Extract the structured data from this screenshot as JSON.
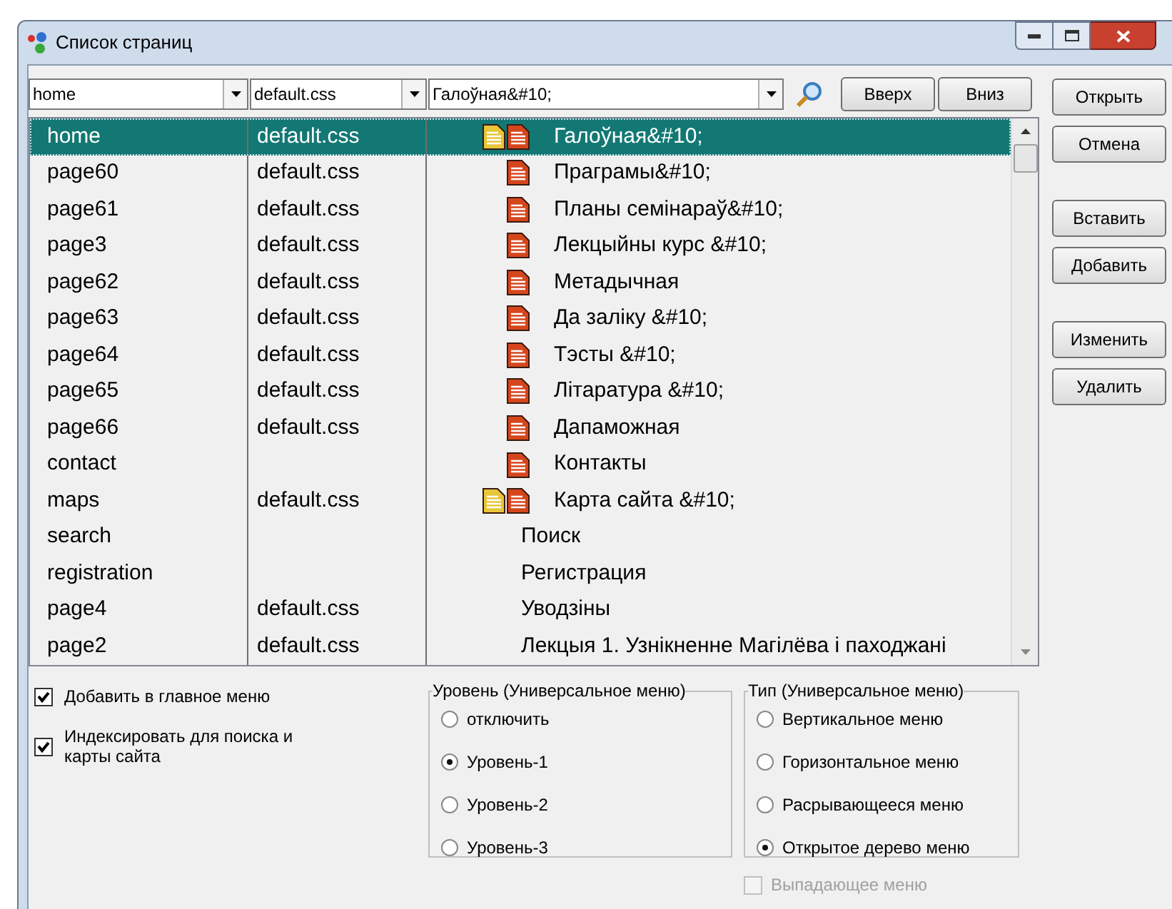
{
  "window": {
    "title": "Список страниц"
  },
  "filters": {
    "page": "home",
    "stylesheet": "default.css",
    "title": "Галоўная&#10;"
  },
  "toolbar_buttons": [
    "Вверх",
    "Вниз"
  ],
  "pages": [
    {
      "page": "home",
      "stylesheet": "default.css",
      "icons": [
        {
          "color": "#e8c63a"
        },
        {
          "color": "#d6461c"
        }
      ],
      "title": "Галоўная&#10;",
      "selected": true
    },
    {
      "page": "page60",
      "stylesheet": "default.css",
      "icons": [
        {
          "color": "#d6461c"
        }
      ],
      "title": "Праграмы&#10;",
      "selected": false
    },
    {
      "page": "page61",
      "stylesheet": "default.css",
      "icons": [
        {
          "color": "#d6461c"
        }
      ],
      "title": "Планы семінараў&#10;",
      "selected": false
    },
    {
      "page": "page3",
      "stylesheet": "default.css",
      "icons": [
        {
          "color": "#d6461c"
        }
      ],
      "title": "Лекцыйны курс &#10;",
      "selected": false
    },
    {
      "page": "page62",
      "stylesheet": "default.css",
      "icons": [
        {
          "color": "#d6461c"
        }
      ],
      "title": "Метадычная",
      "selected": false
    },
    {
      "page": "page63",
      "stylesheet": "default.css",
      "icons": [
        {
          "color": "#d6461c"
        }
      ],
      "title": "Да заліку &#10;",
      "selected": false
    },
    {
      "page": "page64",
      "stylesheet": "default.css",
      "icons": [
        {
          "color": "#d6461c"
        }
      ],
      "title": "Тэсты &#10;",
      "selected": false
    },
    {
      "page": "page65",
      "stylesheet": "default.css",
      "icons": [
        {
          "color": "#d6461c"
        }
      ],
      "title": "Літаратура &#10;",
      "selected": false
    },
    {
      "page": "page66",
      "stylesheet": "default.css",
      "icons": [
        {
          "color": "#d6461c"
        }
      ],
      "title": "Дапаможная",
      "selected": false
    },
    {
      "page": "contact",
      "icons": [
        {
          "color": "#d6461c"
        }
      ],
      "title": "Контакты",
      "selected": false
    },
    {
      "page": "maps",
      "stylesheet": "default.css",
      "icons": [
        {
          "color": "#e8c63a"
        },
        {
          "color": "#d6461c"
        }
      ],
      "title": "Карта сайта &#10;",
      "selected": false
    },
    {
      "page": "search",
      "title": "Поиск",
      "selected": false
    },
    {
      "page": "registration",
      "title": "Регистрация",
      "selected": false
    },
    {
      "page": "page4",
      "stylesheet": "default.css",
      "title": "Уводзіны",
      "selected": false
    },
    {
      "page": "page2",
      "stylesheet": "default.css",
      "title": "Лекцыя 1. Узнікненне Магілёва і паходжані",
      "selected": false
    }
  ],
  "action_groups": [
    [
      "Открыть",
      "Отмена"
    ],
    [
      "Вставить",
      "Добавить"
    ],
    [
      "Изменить",
      "Удалить"
    ]
  ],
  "options": [
    {
      "label": "Добавить в главное меню",
      "checked": true
    },
    {
      "label": "Индексировать для поиска и карты сайта",
      "checked": true
    }
  ],
  "level_group": {
    "title": "Уровень (Универсальное меню)",
    "options": [
      {
        "label": "отключить",
        "selected": false
      },
      {
        "label": "Уровень-1",
        "selected": true
      },
      {
        "label": "Уровень-2",
        "selected": false
      },
      {
        "label": "Уровень-3",
        "selected": false
      }
    ]
  },
  "type_group": {
    "title": "Тип (Универсальное меню)",
    "options": [
      {
        "label": "Вертикальное меню",
        "selected": false
      },
      {
        "label": "Горизонтальное меню",
        "selected": false
      },
      {
        "label": "Расрывающееся меню",
        "selected": false
      },
      {
        "label": "Открытое дерево меню",
        "selected": true
      }
    ]
  },
  "dropdown_option": {
    "label": "Выпадающее меню",
    "checked": false,
    "disabled": true
  }
}
